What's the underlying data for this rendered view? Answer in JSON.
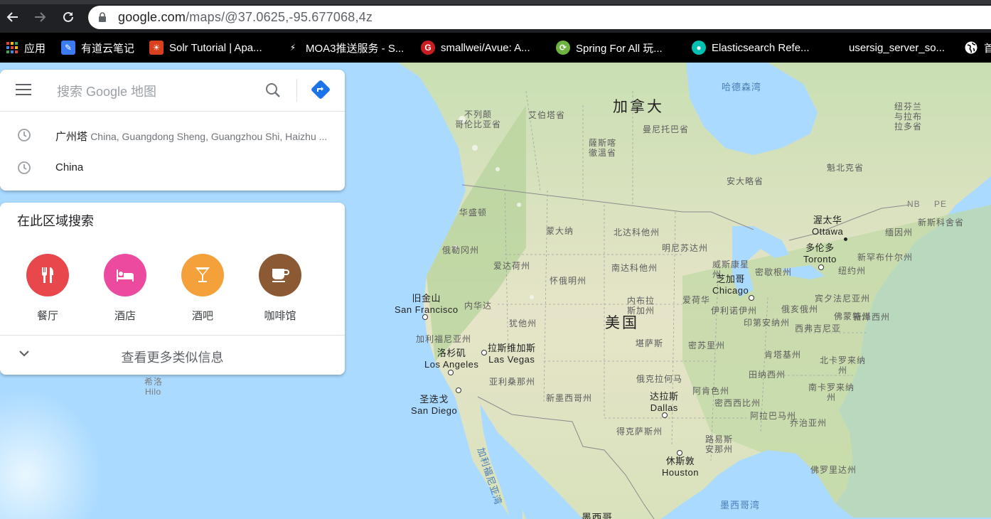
{
  "browser": {
    "url_host": "google.com",
    "url_path": "/maps/@37.0625,-95.677068,4z",
    "bookmarks": [
      {
        "label": "应用",
        "icon": "apps-grid-icon"
      },
      {
        "label": "有道云笔记",
        "icon": "youdao-note-icon",
        "color": "#3b7cf5"
      },
      {
        "label": "Solr Tutorial | Apa...",
        "icon": "solr-icon",
        "color": "#d9411e"
      },
      {
        "label": "MOA3推送服务 - S...",
        "icon": "moa-icon",
        "color": "#000000"
      },
      {
        "label": "smallwei/Avue: A...",
        "icon": "gitee-icon",
        "color": "#c71d23"
      },
      {
        "label": "Spring For All 玩...",
        "icon": "spring-icon",
        "color": "#6db33f"
      },
      {
        "label": "Elasticsearch Refe...",
        "icon": "elastic-icon",
        "color": "#00bfb3"
      },
      {
        "label": "usersig_server_so...",
        "icon": "blank-page-icon"
      },
      {
        "label": "首",
        "icon": "globe-icon"
      }
    ]
  },
  "search": {
    "placeholder": "搜索 Google 地图",
    "history": [
      {
        "title": "广州塔",
        "detail": "China, Guangdong Sheng, Guangzhou Shi, Haizhu ..."
      },
      {
        "title": "China",
        "detail": ""
      }
    ]
  },
  "explore": {
    "title": "在此区域搜索",
    "categories": [
      {
        "label": "餐厅",
        "icon": "restaurant-icon",
        "color": "#e8474c"
      },
      {
        "label": "酒店",
        "icon": "hotel-icon",
        "color": "#ec4a9f"
      },
      {
        "label": "酒吧",
        "icon": "bar-icon",
        "color": "#f4a13b"
      },
      {
        "label": "咖啡馆",
        "icon": "cafe-icon",
        "color": "#8b5a35"
      }
    ],
    "more_label": "查看更多类似信息"
  },
  "map": {
    "countries": {
      "canada": "加拿大",
      "usa": "美国",
      "mexico": "墨西哥"
    },
    "water": {
      "hudson_bay": "哈德森湾",
      "gulf_mexico": "墨西哥湾",
      "gulf_california": "加利福尼亚湾"
    },
    "regions": {
      "bc": "不列颠\n哥伦比亚省",
      "alberta": "艾伯塔省",
      "saskatchewan": "薩斯喀\n徹溫省",
      "manitoba": "曼尼托巴省",
      "ontario": "安大略省",
      "quebec": "魁北克省",
      "newfoundland": "纽芬兰\n与拉布\n拉多省",
      "nb": "NB",
      "pe": "PE",
      "ns": "新斯科舍省",
      "washington": "华盛顿",
      "oregon": "俄勒冈州",
      "idaho": "爱达荷州",
      "montana": "蒙大纳",
      "wyoming": "怀俄明州",
      "nd": "北达科他州",
      "sd": "南达科他州",
      "minnesota": "明尼苏达州",
      "wisconsin": "威斯康星\n州",
      "michigan": "密歇根州",
      "nevada": "内华达",
      "utah": "犹他州",
      "nebraska": "内布拉\n斯加州",
      "iowa": "爱荷华",
      "illinois": "伊利诺伊州",
      "indiana": "印第安纳州",
      "ohio": "俄亥俄州",
      "pennsylvania": "宾夕法尼亚州",
      "ny": "纽约州",
      "vermont": "佛蒙特州",
      "maine": "缅因州",
      "nh": "新罕布什尔州",
      "nj": "新泽西州",
      "california": "加利福尼亚州",
      "arizona": "亚利桑那州",
      "new_mexico": "新墨西哥州",
      "kansas": "堪萨斯",
      "missouri": "密苏里州",
      "oklahoma": "俄克拉何马",
      "arkansas": "阿肯色州",
      "tennessee": "田纳西州",
      "kentucky": "肯塔基州",
      "wv": "西弗吉尼亚",
      "virginia": "弗吉尼亚州",
      "nc": "北卡罗来纳\n州",
      "sc": "南卡罗来纳\n州",
      "mississippi": "密西西比州",
      "alabama": "阿拉巴马州",
      "georgia": "乔治亚州",
      "texas": "得克萨斯州",
      "louisiana": "路易斯\n安那州",
      "florida": "佛罗里达州",
      "hawaii_cn": "希洛",
      "hawaii_en": "Hilo"
    },
    "cities": [
      {
        "cn": "渥太华",
        "en": "Ottawa"
      },
      {
        "cn": "多伦多",
        "en": "Toronto"
      },
      {
        "cn": "芝加哥",
        "en": "Chicago"
      },
      {
        "cn": "旧金山",
        "en": "San Francisco"
      },
      {
        "cn": "洛杉矶",
        "en": "Los Angeles"
      },
      {
        "cn": "拉斯维加斯",
        "en": "Las Vegas"
      },
      {
        "cn": "圣迭戈",
        "en": "San Diego"
      },
      {
        "cn": "达拉斯",
        "en": "Dallas"
      },
      {
        "cn": "休斯敦",
        "en": "Houston"
      }
    ]
  }
}
